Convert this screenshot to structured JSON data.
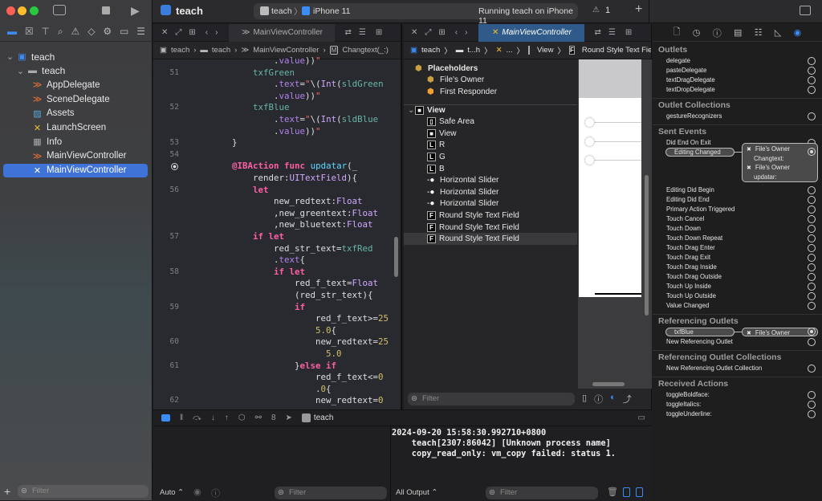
{
  "toolbar": {
    "project": "teach",
    "scheme": "teach",
    "device": "iPhone 11",
    "status": "Running teach on iPhone 11",
    "warnings": "1",
    "add": "+"
  },
  "navigator": {
    "items": [
      {
        "label": "teach",
        "icon": "project-icon"
      },
      {
        "label": "teach",
        "icon": "folder-icon"
      },
      {
        "label": "AppDelegate",
        "icon": "swift-icon"
      },
      {
        "label": "SceneDelegate",
        "icon": "swift-icon"
      },
      {
        "label": "Assets",
        "icon": "assets-icon"
      },
      {
        "label": "LaunchScreen",
        "icon": "storyboard-icon"
      },
      {
        "label": "Info",
        "icon": "plist-icon"
      },
      {
        "label": "MainViewController",
        "icon": "swift-icon"
      },
      {
        "label": "MainViewController",
        "icon": "xib-icon",
        "selected": true
      }
    ],
    "filter_placeholder": "Filter"
  },
  "editor1": {
    "tab": "MainViewController",
    "breadcrumb": [
      "teach",
      "teach",
      "MainViewController",
      "Changtext(_:)"
    ],
    "lines": [
      {
        "n": "",
        "tokens": [
          [
            "                .",
            "plain"
          ],
          [
            "value",
            "prop"
          ],
          [
            "))",
            "plain"
          ],
          [
            "\"",
            "str"
          ]
        ]
      },
      {
        "n": "51",
        "tokens": [
          [
            "            ",
            "plain"
          ],
          [
            "txfGreen",
            "ident"
          ]
        ]
      },
      {
        "n": "",
        "tokens": [
          [
            "                .",
            "plain"
          ],
          [
            "text",
            "prop"
          ],
          [
            "=",
            "plain"
          ],
          [
            "\"",
            "str"
          ],
          [
            "\\(",
            "plain"
          ],
          [
            "Int",
            "type"
          ],
          [
            "(",
            "plain"
          ],
          [
            "sldGreen",
            "ident"
          ]
        ]
      },
      {
        "n": "",
        "tokens": [
          [
            "                .",
            "plain"
          ],
          [
            "value",
            "prop"
          ],
          [
            "))",
            "plain"
          ],
          [
            "\"",
            "str"
          ]
        ]
      },
      {
        "n": "52",
        "tokens": [
          [
            "            ",
            "plain"
          ],
          [
            "txfBlue",
            "ident"
          ]
        ]
      },
      {
        "n": "",
        "tokens": [
          [
            "                .",
            "plain"
          ],
          [
            "text",
            "prop"
          ],
          [
            "=",
            "plain"
          ],
          [
            "\"",
            "str"
          ],
          [
            "\\(",
            "plain"
          ],
          [
            "Int",
            "type"
          ],
          [
            "(",
            "plain"
          ],
          [
            "sldBlue",
            "ident"
          ]
        ]
      },
      {
        "n": "",
        "tokens": [
          [
            "                .",
            "plain"
          ],
          [
            "value",
            "prop"
          ],
          [
            "))",
            "plain"
          ],
          [
            "\"",
            "str"
          ]
        ]
      },
      {
        "n": "53",
        "tokens": [
          [
            "        }",
            "plain"
          ]
        ]
      },
      {
        "n": "54",
        "tokens": [
          [
            "",
            "plain"
          ]
        ]
      },
      {
        "n": "",
        "breakpoint": true,
        "tokens": [
          [
            "        ",
            "plain"
          ],
          [
            "@IBAction",
            "kw"
          ],
          [
            " ",
            "plain"
          ],
          [
            "func",
            "kw"
          ],
          [
            " ",
            "plain"
          ],
          [
            "updatar",
            "fn"
          ],
          [
            "(_",
            "plain"
          ]
        ]
      },
      {
        "n": "",
        "tokens": [
          [
            "            render:",
            "plain"
          ],
          [
            "UITextField",
            "type"
          ],
          [
            "){",
            "plain"
          ]
        ]
      },
      {
        "n": "56",
        "tokens": [
          [
            "            ",
            "plain"
          ],
          [
            "let",
            "kw"
          ]
        ]
      },
      {
        "n": "",
        "tokens": [
          [
            "                new_redtext:",
            "plain"
          ],
          [
            "Float",
            "type"
          ]
        ]
      },
      {
        "n": "",
        "tokens": [
          [
            "                ,new_greentext:",
            "plain"
          ],
          [
            "Float",
            "type"
          ]
        ]
      },
      {
        "n": "",
        "tokens": [
          [
            "                ,new_bluetext:",
            "plain"
          ],
          [
            "Float",
            "type"
          ]
        ]
      },
      {
        "n": "57",
        "tokens": [
          [
            "            ",
            "plain"
          ],
          [
            "if let",
            "kw"
          ]
        ]
      },
      {
        "n": "",
        "tokens": [
          [
            "                red_str_text=",
            "plain"
          ],
          [
            "txfRed",
            "ident"
          ]
        ]
      },
      {
        "n": "",
        "tokens": [
          [
            "                .",
            "plain"
          ],
          [
            "text",
            "prop"
          ],
          [
            "{",
            "plain"
          ]
        ]
      },
      {
        "n": "58",
        "tokens": [
          [
            "                ",
            "plain"
          ],
          [
            "if let",
            "kw"
          ]
        ]
      },
      {
        "n": "",
        "tokens": [
          [
            "                    red_f_text=",
            "plain"
          ],
          [
            "Float",
            "type"
          ]
        ]
      },
      {
        "n": "",
        "tokens": [
          [
            "                    (red_str_text){",
            "plain"
          ]
        ]
      },
      {
        "n": "59",
        "tokens": [
          [
            "                    ",
            "plain"
          ],
          [
            "if",
            "kw"
          ]
        ]
      },
      {
        "n": "",
        "tokens": [
          [
            "                        red_f_text>=",
            "plain"
          ],
          [
            "25",
            "num"
          ]
        ]
      },
      {
        "n": "",
        "tokens": [
          [
            "                        ",
            "plain"
          ],
          [
            "5.0",
            "num"
          ],
          [
            "{",
            "plain"
          ]
        ]
      },
      {
        "n": "60",
        "tokens": [
          [
            "                        new_redtext=",
            "plain"
          ],
          [
            "25",
            "num"
          ]
        ]
      },
      {
        "n": "",
        "tokens": [
          [
            "                          ",
            "plain"
          ],
          [
            "5.0",
            "num"
          ]
        ]
      },
      {
        "n": "61",
        "tokens": [
          [
            "                    }",
            "plain"
          ],
          [
            "else if",
            "kw"
          ]
        ]
      },
      {
        "n": "",
        "tokens": [
          [
            "                        red_f_text<=",
            "plain"
          ],
          [
            "0",
            "num"
          ]
        ]
      },
      {
        "n": "",
        "tokens": [
          [
            "                        .",
            "plain"
          ],
          [
            "0",
            "num"
          ],
          [
            "{",
            "plain"
          ]
        ]
      },
      {
        "n": "62",
        "tokens": [
          [
            "                        new_redtext=",
            "plain"
          ],
          [
            "0",
            "num"
          ]
        ]
      }
    ]
  },
  "editor2": {
    "tab": "MainViewController",
    "breadcrumb": [
      "teach",
      "t...h",
      "...",
      "View",
      "Round Style Text Field"
    ],
    "outline": [
      {
        "label": "Placeholders",
        "icon": "placeholder-cube-icon",
        "level": 0,
        "bold": true
      },
      {
        "label": "File's Owner",
        "icon": "placeholder-cube-icon",
        "level": 1
      },
      {
        "label": "First Responder",
        "icon": "first-responder-icon",
        "level": 1
      },
      {
        "label": "View",
        "icon": "view-icon",
        "level": 0,
        "bold": true,
        "expanded": true
      },
      {
        "label": "Safe Area",
        "icon": "safe-area-icon",
        "level": 1
      },
      {
        "label": "View",
        "icon": "view-icon",
        "level": 1
      },
      {
        "label": "R",
        "icon": "label-icon",
        "level": 1
      },
      {
        "label": "G",
        "icon": "label-icon",
        "level": 1
      },
      {
        "label": "B",
        "icon": "label-icon",
        "level": 1
      },
      {
        "label": "Horizontal Slider",
        "icon": "slider-icon",
        "level": 1
      },
      {
        "label": "Horizontal Slider",
        "icon": "slider-icon",
        "level": 1
      },
      {
        "label": "Horizontal Slider",
        "icon": "slider-icon",
        "level": 1
      },
      {
        "label": "Round Style Text Field",
        "icon": "textfield-icon",
        "level": 1
      },
      {
        "label": "Round Style Text Field",
        "icon": "textfield-icon",
        "level": 1
      },
      {
        "label": "Round Style Text Field",
        "icon": "textfield-icon",
        "level": 1,
        "selected": true
      }
    ],
    "filter_placeholder": "Filter"
  },
  "inspector": {
    "sections": [
      {
        "title": "Outlets",
        "rows": [
          {
            "label": "delegate"
          },
          {
            "label": "pasteDelegate"
          },
          {
            "label": "textDragDelegate"
          },
          {
            "label": "textDropDelegate"
          }
        ]
      },
      {
        "title": "Outlet Collections",
        "rows": [
          {
            "label": "gestureRecognizers"
          }
        ]
      },
      {
        "title": "Sent Events",
        "rows": [
          {
            "label": "Did End On Exit"
          },
          {
            "label": "Editing Changed",
            "connected": true,
            "connections": [
              {
                "target": "File's Owner",
                "action": "Changtext:"
              },
              {
                "target": "File's Owner",
                "action": "updatar:"
              }
            ]
          },
          {
            "label": "Editing Did Begin"
          },
          {
            "label": "Editing Did End"
          },
          {
            "label": "Primary Action Triggered"
          },
          {
            "label": "Touch Cancel"
          },
          {
            "label": "Touch Down"
          },
          {
            "label": "Touch Down Repeat"
          },
          {
            "label": "Touch Drag Enter"
          },
          {
            "label": "Touch Drag Exit"
          },
          {
            "label": "Touch Drag Inside"
          },
          {
            "label": "Touch Drag Outside"
          },
          {
            "label": "Touch Up Inside"
          },
          {
            "label": "Touch Up Outside"
          },
          {
            "label": "Value Changed"
          }
        ]
      },
      {
        "title": "Referencing Outlets",
        "rows": [
          {
            "label": "txfBlue",
            "connected": true,
            "connections": [
              {
                "target": "File's Owner"
              }
            ]
          },
          {
            "label": "New Referencing Outlet"
          }
        ]
      },
      {
        "title": "Referencing Outlet Collections",
        "rows": [
          {
            "label": "New Referencing Outlet Collection"
          }
        ]
      },
      {
        "title": "Received Actions",
        "rows": [
          {
            "label": "toggleBoldface:"
          },
          {
            "label": "toggleItalics:"
          },
          {
            "label": "toggleUnderline:"
          }
        ]
      }
    ]
  },
  "debug": {
    "process": "teach",
    "auto_label": "Auto ⌃",
    "filter_placeholder": "Filter",
    "output_label": "All Output ⌃",
    "output_filter_placeholder": "Filter",
    "console_lines": [
      "2024-09-20 15:58:30.992710+0800",
      "    teach[2307:86042] [Unknown process name]",
      "    copy_read_only: vm_copy failed: status 1."
    ]
  },
  "colors": {
    "accent": "#3f73d8",
    "selection": "#3f73d8",
    "editor_bg": "#292a30"
  }
}
